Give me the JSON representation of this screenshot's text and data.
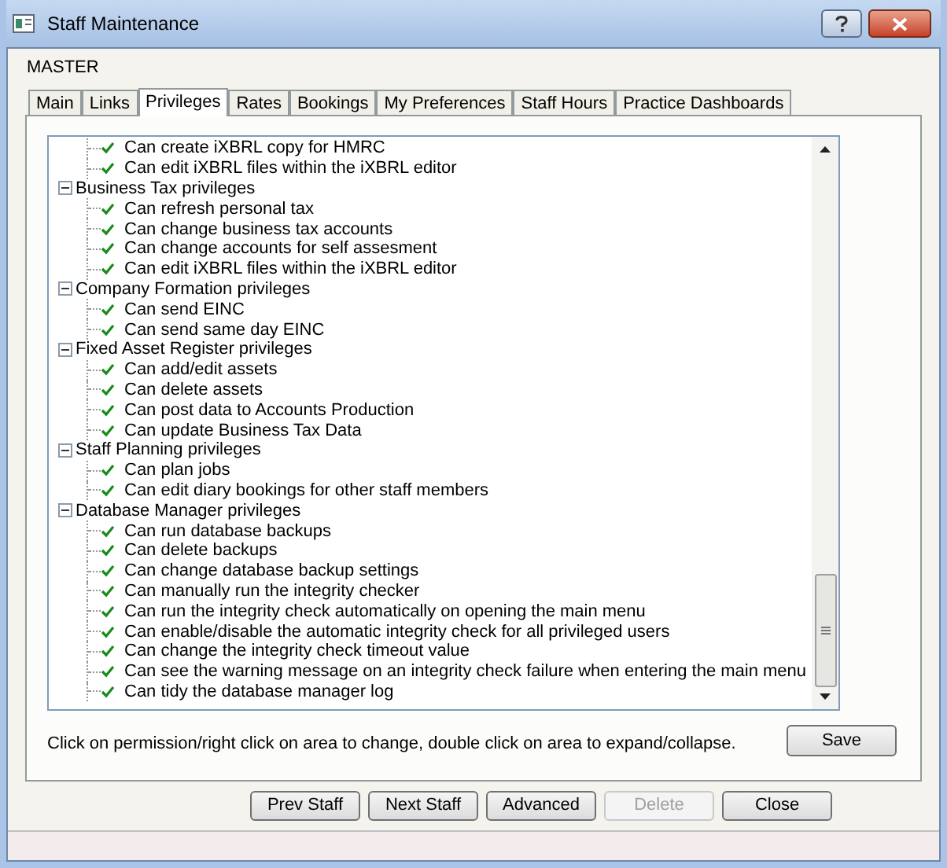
{
  "window": {
    "title": "Staff Maintenance"
  },
  "staff_name": "MASTER",
  "tabs": [
    {
      "label": "Main",
      "selected": false
    },
    {
      "label": "Links",
      "selected": false
    },
    {
      "label": "Privileges",
      "selected": true
    },
    {
      "label": "Rates",
      "selected": false
    },
    {
      "label": "Bookings",
      "selected": false
    },
    {
      "label": "My Preferences",
      "selected": false
    },
    {
      "label": "Staff Hours",
      "selected": false
    },
    {
      "label": "Practice Dashboards",
      "selected": false
    }
  ],
  "tree": [
    {
      "children": [
        {
          "label": "Can create iXBRL copy for HMRC",
          "checked": true
        },
        {
          "label": "Can edit iXBRL files within the iXBRL editor",
          "checked": true
        }
      ]
    },
    {
      "label": "Business Tax privileges",
      "expanded": true,
      "children": [
        {
          "label": "Can refresh personal tax",
          "checked": true
        },
        {
          "label": "Can change business tax accounts",
          "checked": true
        },
        {
          "label": "Can change accounts for self assesment",
          "checked": true
        },
        {
          "label": "Can edit iXBRL files within the iXBRL editor",
          "checked": true
        }
      ]
    },
    {
      "label": "Company Formation privileges",
      "expanded": true,
      "children": [
        {
          "label": "Can send EINC",
          "checked": true
        },
        {
          "label": "Can send same day EINC",
          "checked": true
        }
      ]
    },
    {
      "label": "Fixed Asset Register privileges",
      "expanded": true,
      "children": [
        {
          "label": "Can add/edit assets",
          "checked": true
        },
        {
          "label": "Can delete assets",
          "checked": true
        },
        {
          "label": "Can post data to Accounts Production",
          "checked": true
        },
        {
          "label": "Can update Business Tax Data",
          "checked": true
        }
      ]
    },
    {
      "label": "Staff Planning privileges",
      "expanded": true,
      "children": [
        {
          "label": "Can plan jobs",
          "checked": true
        },
        {
          "label": "Can edit diary bookings for other staff members",
          "checked": true
        }
      ]
    },
    {
      "label": "Database Manager privileges",
      "expanded": true,
      "children": [
        {
          "label": "Can run database backups",
          "checked": true
        },
        {
          "label": "Can delete backups",
          "checked": true
        },
        {
          "label": "Can change database backup settings",
          "checked": true
        },
        {
          "label": "Can manually run the integrity checker",
          "checked": true
        },
        {
          "label": "Can run the integrity check automatically on opening the main menu",
          "checked": true
        },
        {
          "label": "Can enable/disable the automatic integrity check for all privileged users",
          "checked": true
        },
        {
          "label": "Can change the integrity check timeout value",
          "checked": true
        },
        {
          "label": "Can see the warning message on an integrity check failure when entering the main menu",
          "checked": true
        },
        {
          "label": "Can tidy the database manager log",
          "checked": true
        }
      ]
    }
  ],
  "help_text": "Click on permission/right click on area to change, double click on area to expand/collapse.",
  "save_button": "Save",
  "buttons": [
    {
      "label": "Prev Staff",
      "disabled": false
    },
    {
      "label": "Next Staff",
      "disabled": false
    },
    {
      "label": "Advanced",
      "disabled": false
    },
    {
      "label": "Delete",
      "disabled": true
    },
    {
      "label": "Close",
      "disabled": false
    }
  ]
}
